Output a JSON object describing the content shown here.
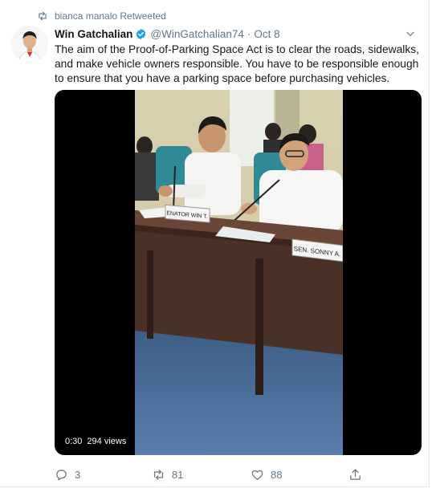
{
  "retweet_context": {
    "text": "bianca manalo Retweeted"
  },
  "tweet": {
    "author_name": "Win Gatchalian",
    "author_handle": "@WinGatchalian74",
    "separator": "·",
    "date": "Oct 8",
    "text": "The aim of the Proof-of-Parking Space Act is to clear the roads, sidewalks, and make vehicle owners responsible. You have to be responsible enough to ensure that you have a parking space before purchasing vehicles."
  },
  "video": {
    "duration": "0:30",
    "views": "294 views",
    "placards": [
      "SEN. SONNY A.",
      "ENATOR WIN T."
    ]
  },
  "actions": {
    "replies": "3",
    "retweets": "81",
    "likes": "88"
  },
  "colors": {
    "secondary_text": "#657786",
    "verified_blue": "#1da1f2",
    "retweet_green": "#657786"
  }
}
